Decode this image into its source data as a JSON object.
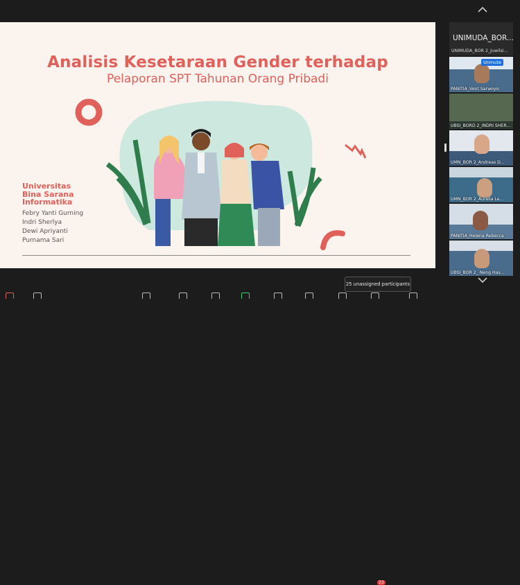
{
  "slide": {
    "title": "Analisis Kesetaraan Gender terhadap",
    "subtitle": "Pelaporan SPT Tahunan Orang Pribadi",
    "university_lines": [
      "Universitas",
      "Bina Sarana",
      "Informatika"
    ],
    "authors": [
      "Febry Yanti Gurning",
      "Indri Sherlya",
      "Dewi Apriyanti",
      "Purnama Sari"
    ]
  },
  "panel": {
    "header_name": "UNIMUDA_BOR...",
    "header_sub": "UNIMUDA_BOR 2_Juwilsi...",
    "unmute_label": "Unmute",
    "tiles": [
      {
        "label": "PANITIA_Vent Sarwoyo"
      },
      {
        "label": "UBSI_BORD 2_INDRI SHER..."
      },
      {
        "label": "UMN_BOR 2_Andreas D..."
      },
      {
        "label": "UMN_BOR 2_Aurelia Le..."
      },
      {
        "label": "PANITIA_Helena Rebecca"
      },
      {
        "label": "UBSI_BOR 2_ Neng Has..."
      }
    ]
  },
  "tooltip": "25 unassigned participants",
  "badge": "23",
  "icons": {
    "scroll_up": "chevron-up-icon",
    "scroll_down": "chevron-down-icon"
  },
  "colors": {
    "accent": "#e0605a",
    "slide_bg": "#fbf3ee",
    "badge": "#e8363a"
  }
}
